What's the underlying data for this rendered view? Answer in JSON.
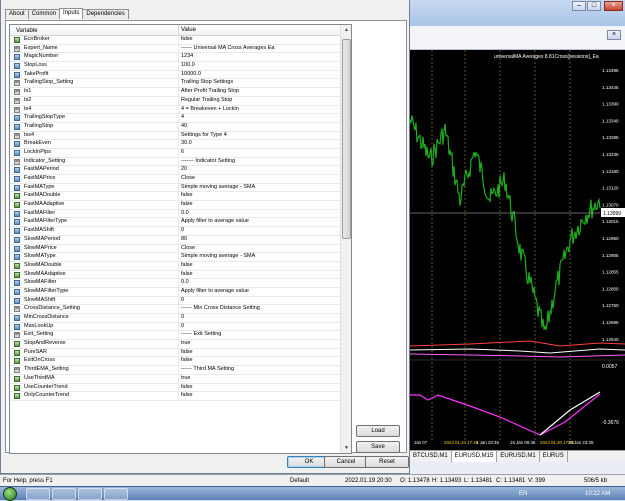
{
  "dialog": {
    "tabs": [
      {
        "label": "About"
      },
      {
        "label": "Common"
      },
      {
        "label": "Inputs"
      },
      {
        "label": "Dependencies"
      }
    ],
    "columns": {
      "variable": "Variable",
      "value": "Value"
    },
    "rows": [
      {
        "name": "EcnBroker",
        "value": "false",
        "icon": "bool"
      },
      {
        "name": "Expert_Name",
        "value": "------ Universal MA Cross Averages Ea",
        "icon": "ab"
      },
      {
        "name": "MagicNumber",
        "value": "1234",
        "icon": "num"
      },
      {
        "name": "StopLoss",
        "value": "100.0",
        "icon": "num"
      },
      {
        "name": "TakeProfit",
        "value": "10000.0",
        "icon": "num"
      },
      {
        "name": "TrailingStop_Setting",
        "value": "Trailing Stop Settings",
        "icon": "ab"
      },
      {
        "name": "ts1",
        "value": "After Profit Trailing Stop",
        "icon": "ab"
      },
      {
        "name": "ts2",
        "value": "Regular Trailing Stop",
        "icon": "ab"
      },
      {
        "name": "ts4",
        "value": "4 = Breakeven + Lockin",
        "icon": "ab"
      },
      {
        "name": "TrailingStopType",
        "value": "4",
        "icon": "num"
      },
      {
        "name": "TrailingStop",
        "value": "40",
        "icon": "num"
      },
      {
        "name": "tss4",
        "value": "Settings for Type 4",
        "icon": "ab"
      },
      {
        "name": "BreakEven",
        "value": "30.0",
        "icon": "num"
      },
      {
        "name": "LockInPips",
        "value": "6",
        "icon": "num"
      },
      {
        "name": "Indicator_Setting",
        "value": "------- Indicator Setting",
        "icon": "ab"
      },
      {
        "name": "FastMAPeriod",
        "value": "20",
        "icon": "num"
      },
      {
        "name": "FastMAPrice",
        "value": "Close",
        "icon": "num"
      },
      {
        "name": "FastMAType",
        "value": "Simple moving average - SMA",
        "icon": "num"
      },
      {
        "name": "FastMADouble",
        "value": "false",
        "icon": "bool"
      },
      {
        "name": "FastMAAdaptive",
        "value": "false",
        "icon": "bool"
      },
      {
        "name": "FastMAFilter",
        "value": "0.0",
        "icon": "num"
      },
      {
        "name": "FastMAFilterType",
        "value": "Apply filter to average value",
        "icon": "num"
      },
      {
        "name": "FastMAShift",
        "value": "0",
        "icon": "num"
      },
      {
        "name": "SlowMAPeriod",
        "value": "80",
        "icon": "num"
      },
      {
        "name": "SlowMAPrice",
        "value": "Close",
        "icon": "num"
      },
      {
        "name": "SlowMAType",
        "value": "Simple moving average - SMA",
        "icon": "num"
      },
      {
        "name": "SlowMADouble",
        "value": "false",
        "icon": "bool"
      },
      {
        "name": "SlowMAAdaptive",
        "value": "false",
        "icon": "bool"
      },
      {
        "name": "SlowMAFilter",
        "value": "0.0",
        "icon": "num"
      },
      {
        "name": "SlowMAFilterType",
        "value": "Apply filter to average value",
        "icon": "num"
      },
      {
        "name": "SlowMAShift",
        "value": "0",
        "icon": "num"
      },
      {
        "name": "CrossDistance_Setting",
        "value": "------ Min Cross Distance Setting",
        "icon": "ab"
      },
      {
        "name": "MinCrossDistance",
        "value": "0",
        "icon": "num"
      },
      {
        "name": "MaxLookUp",
        "value": "0",
        "icon": "num"
      },
      {
        "name": "Exit_Setting",
        "value": "------ Exit Setting",
        "icon": "ab"
      },
      {
        "name": "StopAndReverse",
        "value": "true",
        "icon": "bool"
      },
      {
        "name": "PureSAR",
        "value": "false",
        "icon": "bool"
      },
      {
        "name": "ExitOnCross",
        "value": "false",
        "icon": "bool"
      },
      {
        "name": "ThirdEMA_Setting",
        "value": "------ Third MA Setting",
        "icon": "ab"
      },
      {
        "name": "UseThirdMA",
        "value": "true",
        "icon": "bool"
      },
      {
        "name": "UseCounterTrend",
        "value": "false",
        "icon": "bool"
      },
      {
        "name": "OnlyCounterTrend",
        "value": "false",
        "icon": "bool"
      }
    ],
    "buttons": {
      "load": "Load",
      "save": "Save",
      "ok": "OK",
      "cancel": "Cancel",
      "reset": "Reset"
    }
  },
  "chart": {
    "title": "universalMA Averages 8.81Cross[sessions]_Ea",
    "prices": [
      "1.13495",
      "1.13445",
      "1.13390",
      "1.13340",
      "1.13285",
      "1.13235",
      "1.13180",
      "1.13120",
      "1.13070",
      "1.13015",
      "1.12960",
      "1.12905",
      "1.12855",
      "1.12800",
      "1.12750",
      "1.12695",
      "1.12640"
    ],
    "current_price": "1.13999",
    "indicator_label": "0.0057",
    "dates": [
      "Jan 07",
      "2022.01.24 17:46",
      "1 Jan 23:46",
      "15 Jan 06:45",
      "2022.01.20 17:15",
      "25 Jan 23:45"
    ],
    "bottom_label": "-0.3676"
  },
  "symbol_tabs": [
    "BTCUSD,M1",
    "EURUSD,M15",
    "EURUSD,M1",
    "EURUS"
  ],
  "statusbar": {
    "help": "For Help, press F1",
    "profile": "Default",
    "time": "2022.01.19 20:30",
    "open": "O: 1.13478",
    "high": "H: 1.13493",
    "low": "L: 1.13481",
    "close": "C: 1.13481",
    "volume": "V: 399",
    "traffic": "506/5 kb"
  },
  "tray": {
    "lang": "EN",
    "clock": "10:22 AM"
  }
}
